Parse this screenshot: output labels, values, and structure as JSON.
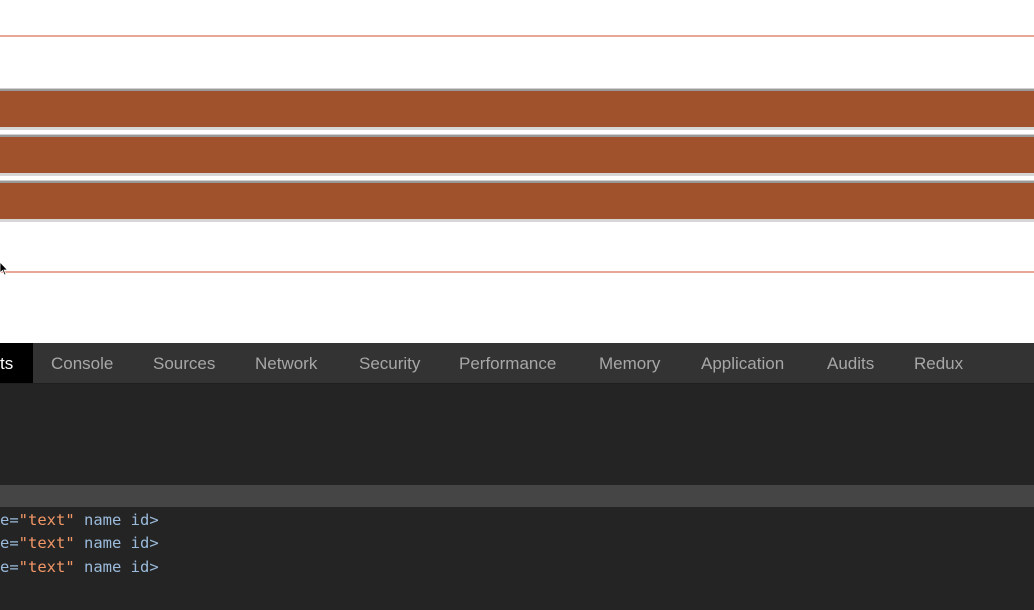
{
  "devtools": {
    "tabs": [
      {
        "label": "ts",
        "active": true
      },
      {
        "label": "Console",
        "active": false
      },
      {
        "label": "Sources",
        "active": false
      },
      {
        "label": "Network",
        "active": false
      },
      {
        "label": "Security",
        "active": false
      },
      {
        "label": "Performance",
        "active": false
      },
      {
        "label": "Memory",
        "active": false
      },
      {
        "label": "Application",
        "active": false
      },
      {
        "label": "Audits",
        "active": false
      },
      {
        "label": "Redux",
        "active": false
      }
    ],
    "code_lines": [
      {
        "attr_prefix": "e=",
        "value": "\"text\"",
        "rest": " name id>"
      },
      {
        "attr_prefix": "e=",
        "value": "\"text\"",
        "rest": " name id>"
      },
      {
        "attr_prefix": "e=",
        "value": "\"text\"",
        "rest": " name id>"
      }
    ]
  },
  "colors": {
    "bar_fill": "#a0522d",
    "guide_line": "#e8a697",
    "devtools_bg": "#242424",
    "tabbar_bg": "#333333",
    "string_value": "#f29766",
    "attribute": "#9bbbdc"
  }
}
